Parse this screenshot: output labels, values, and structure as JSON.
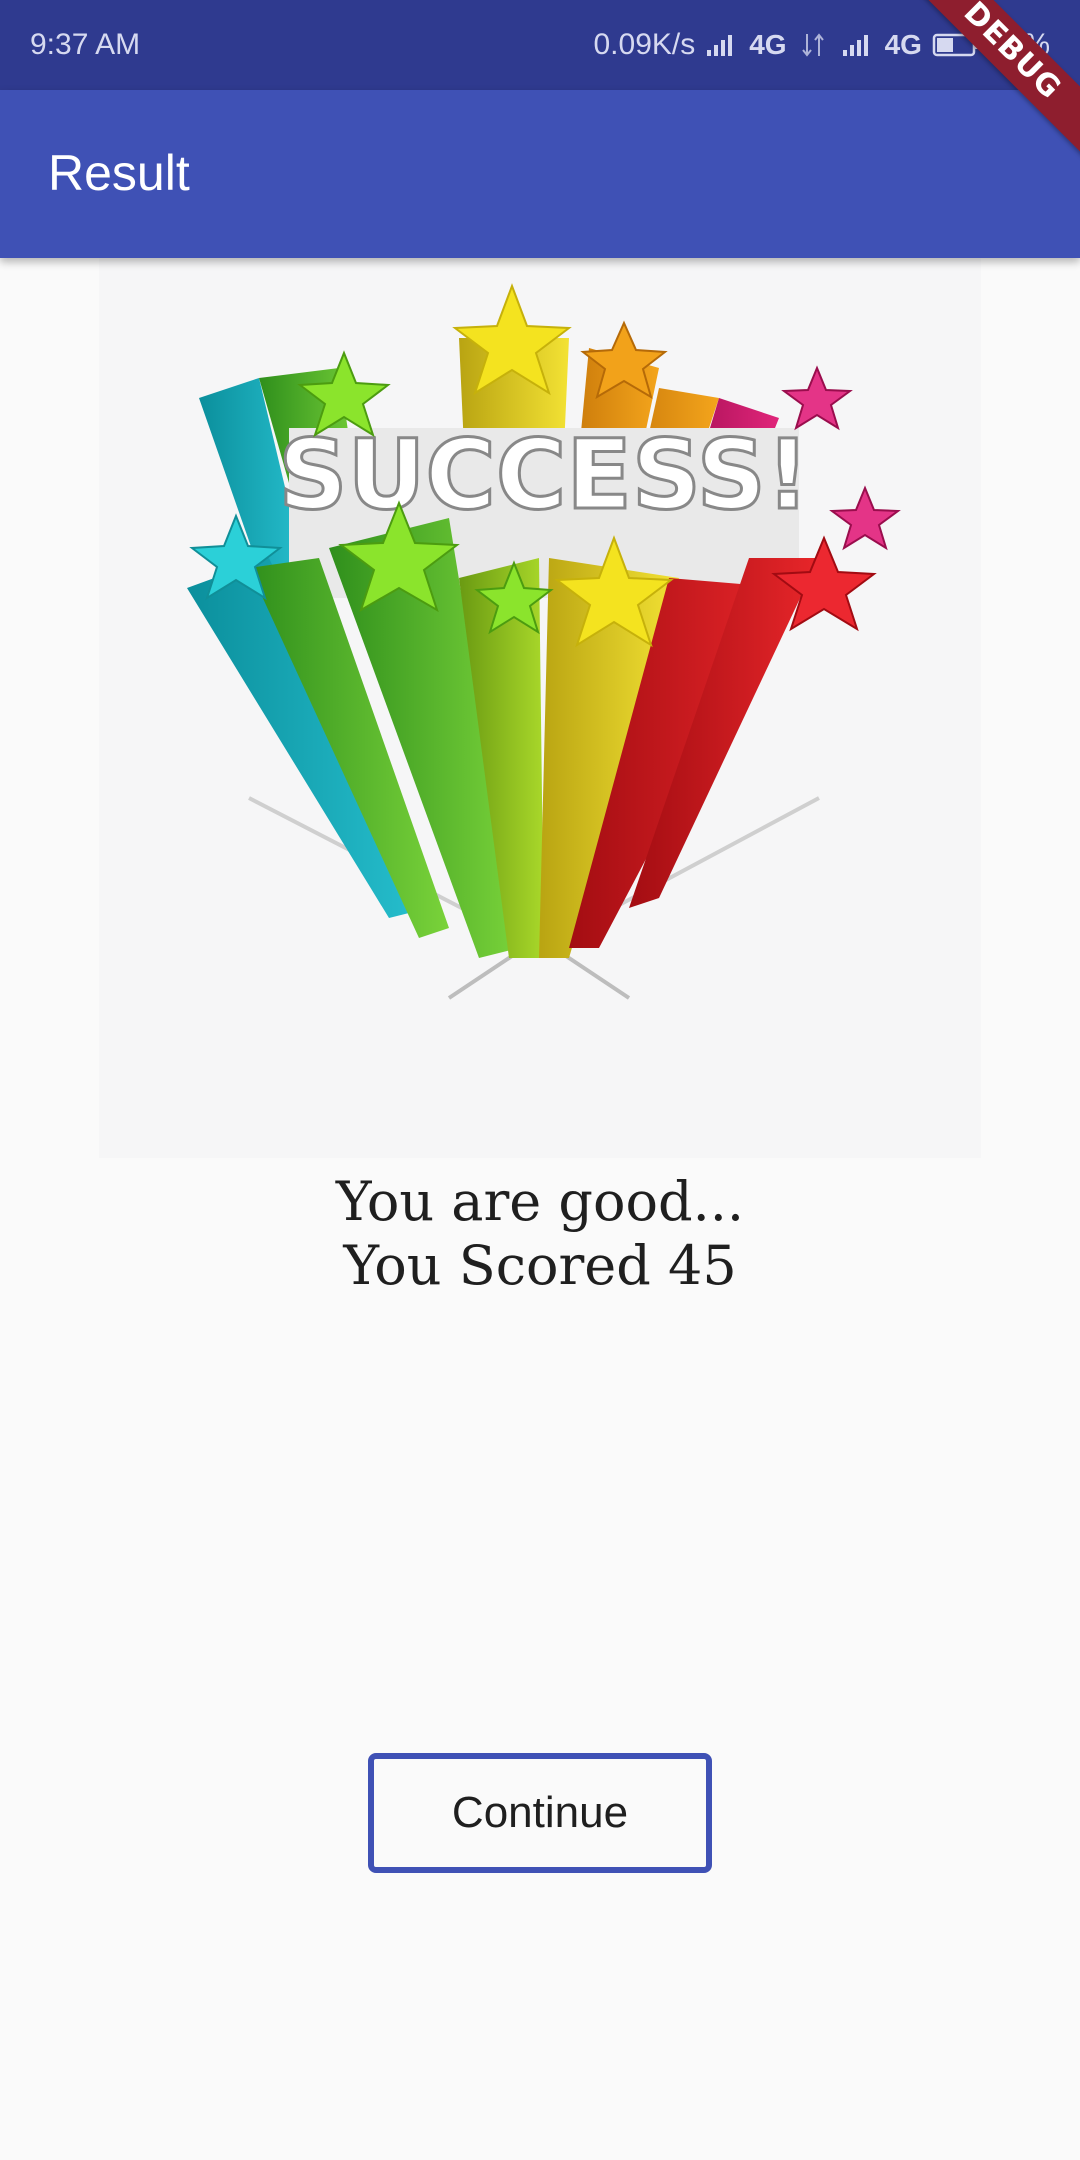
{
  "status_bar": {
    "time": "9:37 AM",
    "speed": "0.09K/s",
    "network_1": "4G",
    "network_2": "4G",
    "battery": "42%"
  },
  "app_bar": {
    "title": "Result"
  },
  "debug_banner": {
    "label": "DEBUG",
    "color": "#8e1e2e"
  },
  "hero_image": {
    "text": "SUCCESS!"
  },
  "result": {
    "message": "You are good...",
    "score_line": "You Scored 45"
  },
  "actions": {
    "continue_label": "Continue"
  },
  "colors": {
    "status_bar": "#2f3a8f",
    "app_bar": "#3f51b5",
    "button_border": "#3f51b5",
    "background": "#fafafa"
  }
}
